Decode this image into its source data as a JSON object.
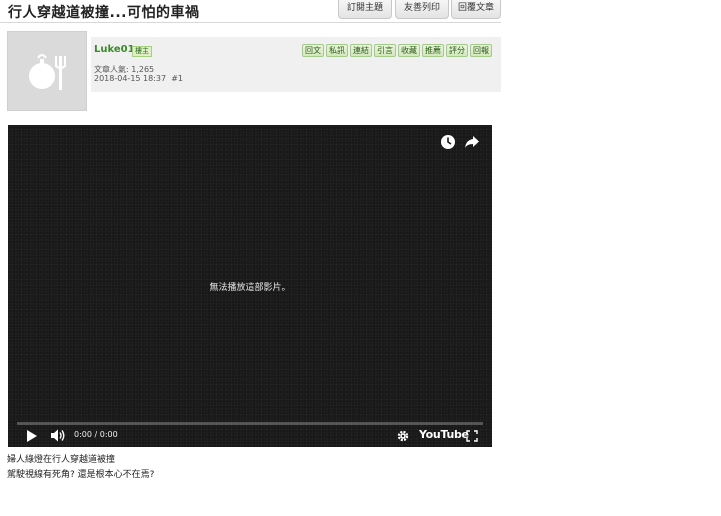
{
  "thread": {
    "title": "行人穿越道被撞...可怕的車禍"
  },
  "top_buttons": {
    "subscribe": "訂閱主題",
    "print": "友善列印",
    "reply": "回覆文章"
  },
  "post": {
    "username": "Luke01",
    "role_badge": "樓主",
    "popularity": "文章人氣: 1,265",
    "date": "2018-04-15 18:37",
    "floor": "#1",
    "actions": [
      "回文",
      "私訊",
      "連結",
      "引言",
      "收藏",
      "推薦",
      "評分",
      "回報"
    ],
    "body_lines": [
      "婦人綠燈在行人穿越道被撞",
      "駕駛視線有死角? 還是根本心不在焉?"
    ]
  },
  "video": {
    "message": "無法播放這部影片。",
    "time": "0:00 / 0:00",
    "logo_text": "YouTube",
    "icons": [
      "clock-icon",
      "share-icon",
      "play-icon",
      "volume-icon",
      "gear-icon",
      "fullscreen-icon"
    ]
  },
  "colors": {
    "username_green": "#3c8a2a",
    "action_button_bg": "#d3e8bc",
    "video_bg": "#181818"
  }
}
